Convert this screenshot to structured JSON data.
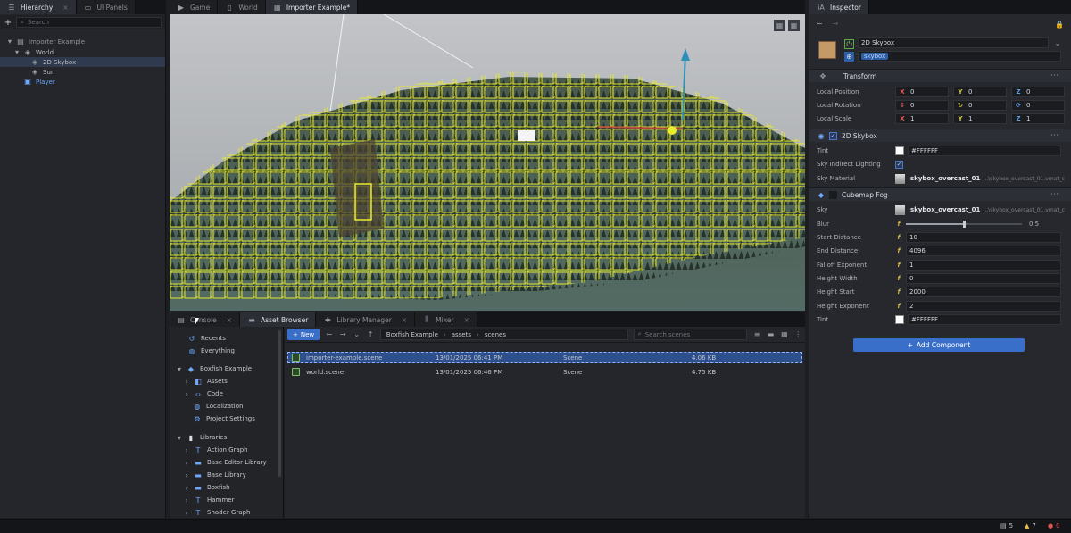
{
  "hierarchy": {
    "tabs": [
      {
        "label": "Hierarchy",
        "active": true
      },
      {
        "label": "UI Panels",
        "active": false
      }
    ],
    "search_placeholder": "Search",
    "tree": [
      {
        "label": "Importer Example",
        "level": 0,
        "icon": "scene-icon"
      },
      {
        "label": "World",
        "level": 1,
        "icon": "gameobject-icon"
      },
      {
        "label": "2D Skybox",
        "level": 2,
        "icon": "gameobject-icon",
        "selected": true
      },
      {
        "label": "Sun",
        "level": 2,
        "icon": "gameobject-icon"
      },
      {
        "label": "Player",
        "level": 1,
        "icon": "prefab-icon",
        "color": "#6ea8ff"
      }
    ]
  },
  "editor_tabs": [
    {
      "label": "Game",
      "icon": "game-icon"
    },
    {
      "label": "World",
      "icon": "file-icon"
    },
    {
      "label": "Importer Example*",
      "icon": "grid-icon",
      "active": true
    }
  ],
  "bottom_tabs": [
    {
      "label": "Console",
      "icon": "console-icon"
    },
    {
      "label": "Asset Browser",
      "icon": "folder-icon",
      "active": true
    },
    {
      "label": "Library Manager",
      "icon": "puzzle-icon"
    },
    {
      "label": "Mixer",
      "icon": "mixer-icon"
    }
  ],
  "asset_sidebar": {
    "items": [
      {
        "label": "Recents",
        "icon": "history-icon",
        "level": 0
      },
      {
        "label": "Everything",
        "icon": "globe-icon",
        "level": 0
      },
      {
        "label": "Boxfish Example",
        "icon": "gamepad-icon",
        "level": 0,
        "expanded": true
      },
      {
        "label": "Assets",
        "icon": "cube-icon",
        "level": 1
      },
      {
        "label": "Code",
        "icon": "code-icon",
        "level": 1
      },
      {
        "label": "Localization",
        "icon": "globe-icon",
        "level": 1
      },
      {
        "label": "Project Settings",
        "icon": "settings-icon",
        "level": 1
      },
      {
        "label": "Libraries",
        "icon": "book-icon",
        "level": 0,
        "expanded": true
      },
      {
        "label": "Action Graph",
        "icon": "graph-icon",
        "level": 1
      },
      {
        "label": "Base Editor Library",
        "icon": "library-icon",
        "level": 1
      },
      {
        "label": "Base Library",
        "icon": "library-icon",
        "level": 1
      },
      {
        "label": "Boxfish",
        "icon": "library-icon",
        "level": 1
      },
      {
        "label": "Hammer",
        "icon": "hammer-icon",
        "level": 1
      },
      {
        "label": "Shader Graph",
        "icon": "graph-icon",
        "level": 1
      }
    ]
  },
  "asset_browser": {
    "new_label": "New",
    "breadcrumb": [
      "Boxfish Example",
      "assets",
      "scenes"
    ],
    "search_placeholder": "Search scenes",
    "files": [
      {
        "name": "importer-example.scene",
        "date": "13/01/2025 06:41 PM",
        "type": "Scene",
        "size": "4.06 KB",
        "selected": true
      },
      {
        "name": "world.scene",
        "date": "13/01/2025 06:46 PM",
        "type": "Scene",
        "size": "4.75 KB"
      }
    ]
  },
  "inspector": {
    "tab_label": "Inspector",
    "object_name": "2D Skybox",
    "tag": "skybox",
    "transform": {
      "title": "Transform",
      "rows": [
        {
          "label": "Local Position",
          "x": "0",
          "y": "0",
          "z": "0"
        },
        {
          "label": "Local Rotation",
          "x": "0",
          "y": "0",
          "z": "0"
        },
        {
          "label": "Local Scale",
          "x": "1",
          "y": "1",
          "z": "1"
        }
      ]
    },
    "skybox": {
      "title": "2D Skybox",
      "tint_label": "Tint",
      "tint_value": "#FFFFFF",
      "indirect_label": "Sky Indirect Lighting",
      "material_label": "Sky Material",
      "material_name": "skybox_overcast_01",
      "material_path": "..\\skybox_overcast_01.vmat_c"
    },
    "fog": {
      "title": "Cubemap Fog",
      "sky_label": "Sky",
      "sky_name": "skybox_overcast_01",
      "sky_path": "..\\skybox_overcast_01.vmat_c",
      "blur_label": "Blur",
      "blur_value": "0.5",
      "blur_level": 0.5,
      "rows": [
        {
          "label": "Start Distance",
          "value": "10"
        },
        {
          "label": "End Distance",
          "value": "4096"
        },
        {
          "label": "Falloff Exponent",
          "value": "1"
        },
        {
          "label": "Height Width",
          "value": "0"
        },
        {
          "label": "Height Start",
          "value": "2000"
        },
        {
          "label": "Height Exponent",
          "value": "2"
        }
      ],
      "tint_label": "Tint",
      "tint_value": "#FFFFFF"
    },
    "add_component_label": "Add Component"
  },
  "status": {
    "messages": "5",
    "warnings": "7",
    "errors": "0"
  },
  "colors": {
    "accent": "#3a6fc9",
    "selection": "#2d4f8c",
    "gizmo_yellow": "#e8ec2a"
  }
}
